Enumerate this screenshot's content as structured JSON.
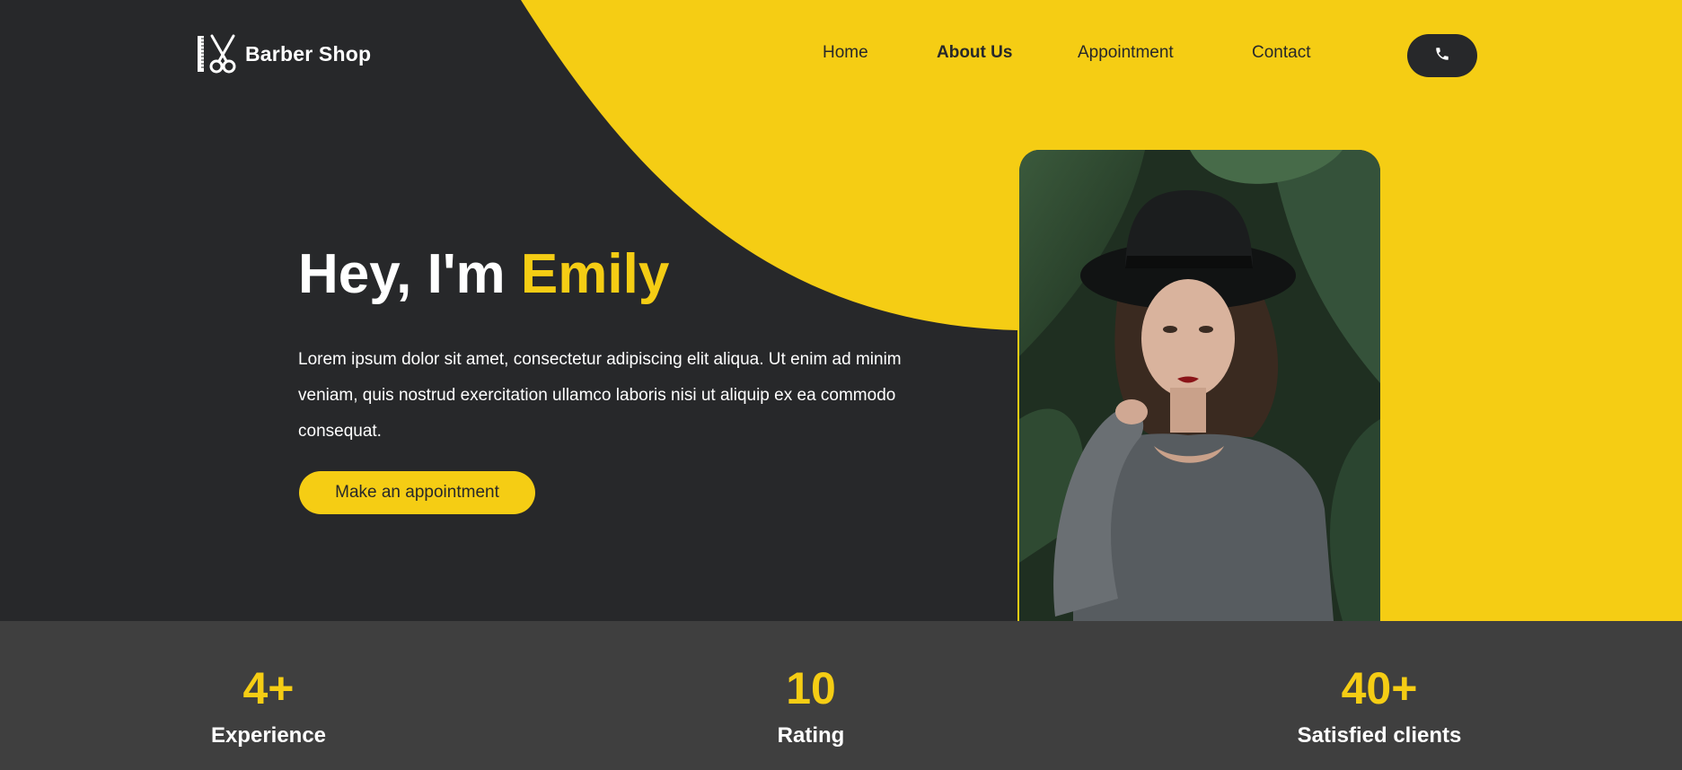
{
  "brand": {
    "name": "Barber Shop",
    "logo_icon": "comb-scissors-icon"
  },
  "nav": {
    "items": [
      {
        "label": "Home",
        "active": false
      },
      {
        "label": "About Us",
        "active": true
      },
      {
        "label": "Appointment",
        "active": false
      },
      {
        "label": "Contact",
        "active": false
      }
    ],
    "call_icon": "phone-icon"
  },
  "hero": {
    "title_prefix": "Hey, I'm ",
    "title_name": "Emily",
    "description": "Lorem ipsum dolor sit amet, consectetur adipiscing elit aliqua. Ut enim ad minim veniam, quis nostrud exercitation ullamco laboris nisi ut aliquip ex ea commodo consequat.",
    "cta_label": "Make an appointment"
  },
  "stats": [
    {
      "value": "4+",
      "label": "Experience"
    },
    {
      "value": "10",
      "label": "Rating"
    },
    {
      "value": "40+",
      "label": "Satisfied clients"
    }
  ],
  "colors": {
    "accent": "#f5cd14",
    "dark": "#27282a",
    "stats_bg": "#3f3f3f"
  }
}
